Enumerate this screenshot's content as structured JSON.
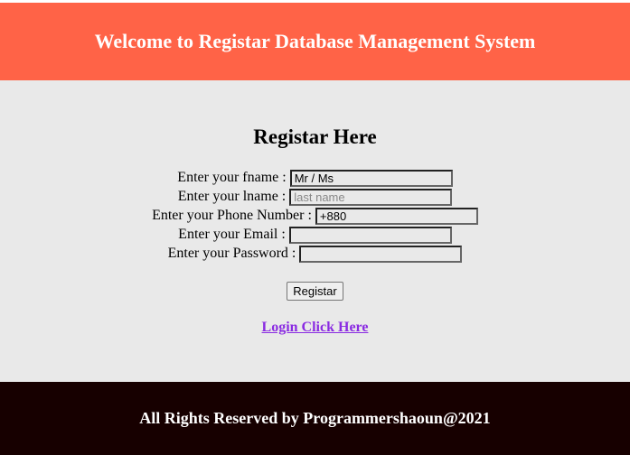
{
  "header": {
    "title": "Welcome to Registar Database Management System"
  },
  "form": {
    "title": "Registar Here",
    "fields": [
      {
        "label": "Enter your fname :",
        "value": "Mr / Ms",
        "placeholder": ""
      },
      {
        "label": "Enter your lname :",
        "value": "",
        "placeholder": "last name"
      },
      {
        "label": "Enter your Phone Number :",
        "value": "+880",
        "placeholder": ""
      },
      {
        "label": "Enter your Email :",
        "value": "",
        "placeholder": ""
      },
      {
        "label": "Enter your Password :",
        "value": "",
        "placeholder": ""
      }
    ],
    "submit_label": "Registar",
    "login_link": "Login Click Here"
  },
  "footer": {
    "text": "All Rights Reserved by Programmershaoun@2021"
  },
  "colors": {
    "header": "#ff6347",
    "footer": "#170000",
    "link": "#8a2be2"
  }
}
